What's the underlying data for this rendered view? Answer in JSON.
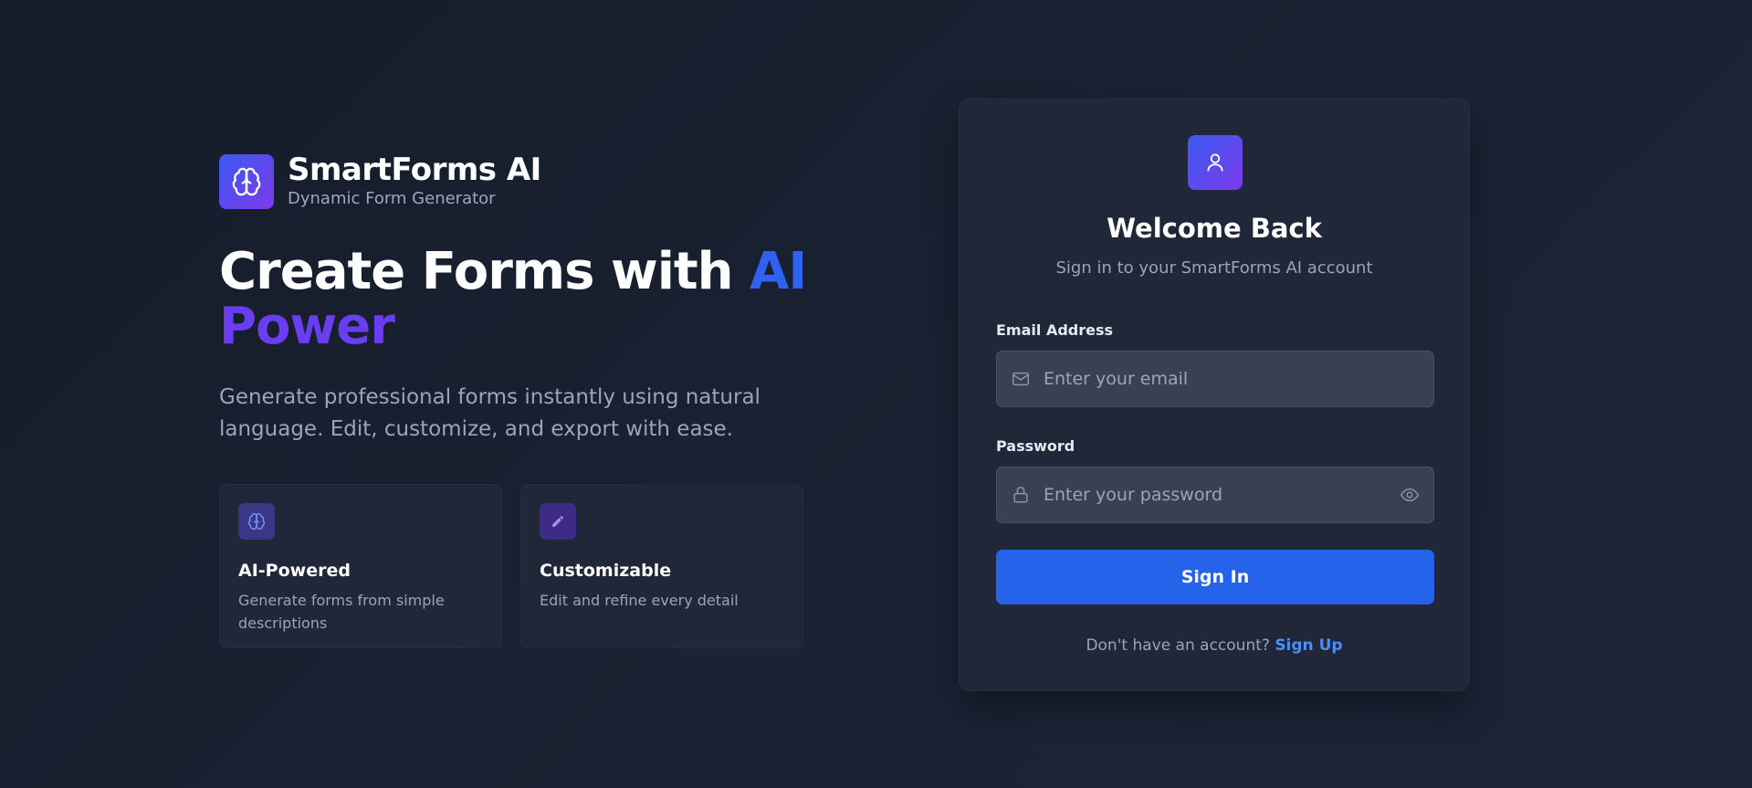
{
  "brand": {
    "name": "SmartForms AI",
    "tagline": "Dynamic Form Generator",
    "logo_icon": "brain-icon"
  },
  "hero": {
    "headline_part1": "Create Forms with ",
    "headline_accent1": "AI",
    "headline_accent2": "Power",
    "subtext": "Generate professional forms instantly using natural language. Edit, customize, and export with ease."
  },
  "features": [
    {
      "icon": "brain-icon",
      "title": "AI-Powered",
      "description": "Generate forms from simple descriptions"
    },
    {
      "icon": "pencil-icon",
      "title": "Customizable",
      "description": "Edit and refine every detail"
    }
  ],
  "login": {
    "avatar_icon": "user-icon",
    "title": "Welcome Back",
    "subtitle": "Sign in to your SmartForms AI account",
    "email_label": "Email Address",
    "email_placeholder": "Enter your email",
    "email_value": "",
    "password_label": "Password",
    "password_placeholder": "Enter your password",
    "password_value": "",
    "signin_label": "Sign In",
    "signup_prompt": "Don't have an account? ",
    "signup_link": "Sign Up"
  },
  "colors": {
    "background": "#1a2233",
    "card": "#1f2738",
    "primary_button": "#2563eb",
    "accent_blue": "#2f62f0",
    "accent_purple": "#6a3df0",
    "link": "#4d8df5"
  }
}
